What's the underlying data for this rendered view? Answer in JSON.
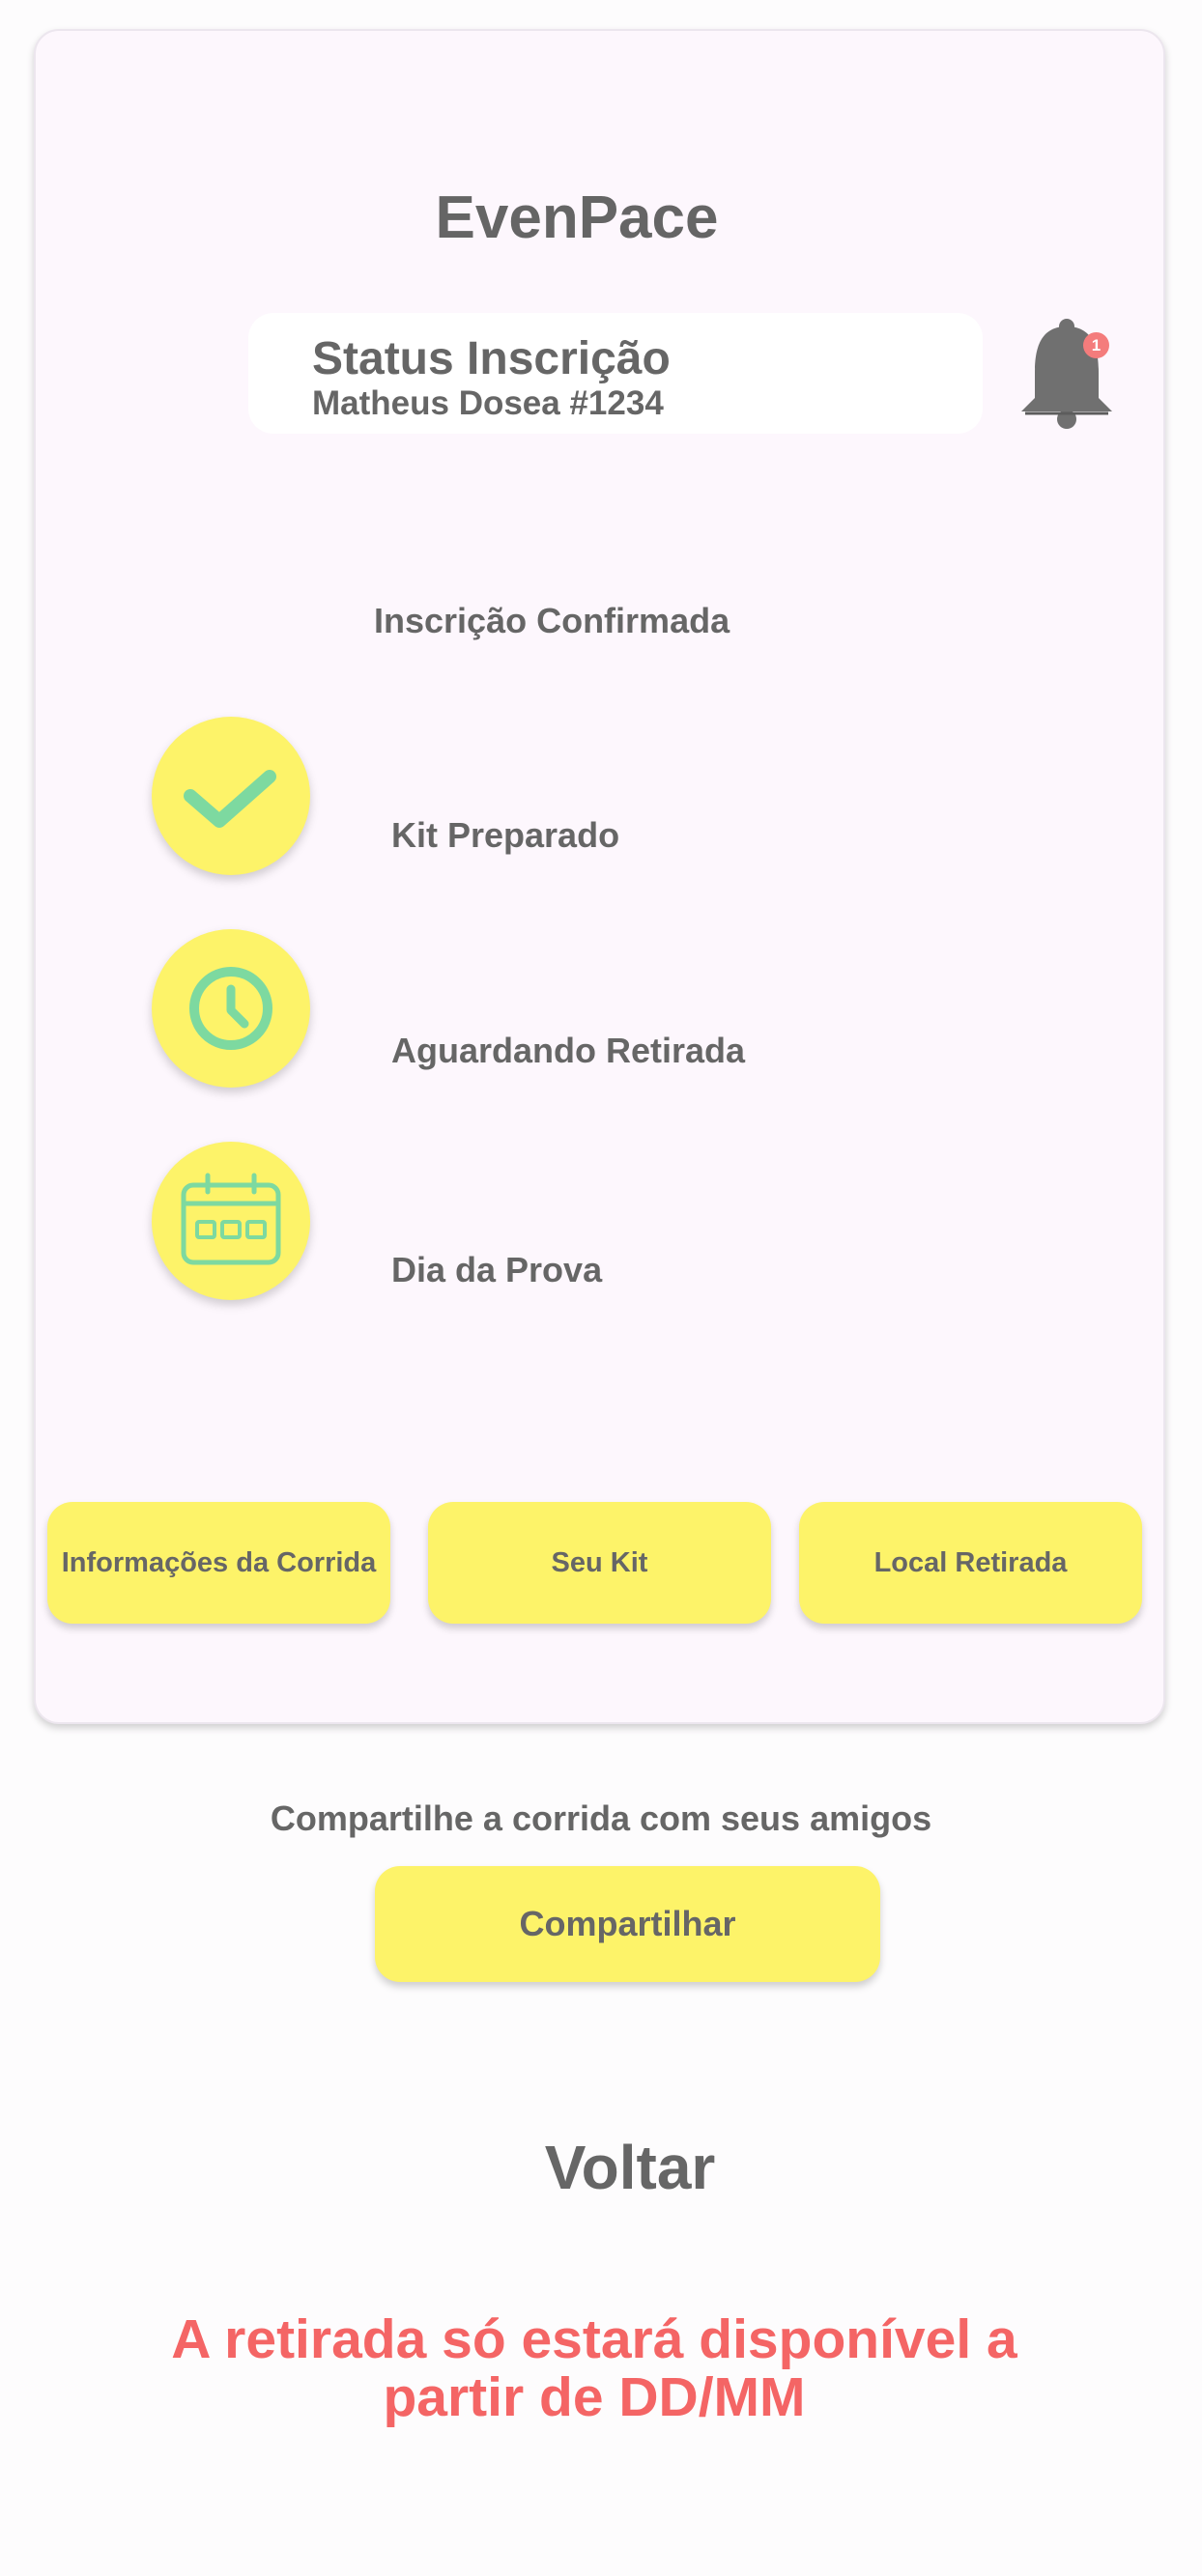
{
  "app": {
    "title": "EvenPace"
  },
  "status": {
    "title": "Status Inscrição",
    "subtitle": "Matheus Dosea #1234",
    "notification_count": "1"
  },
  "progress": {
    "confirmed_label": "Inscrição Confirmada",
    "steps": [
      {
        "label": "Kit Preparado",
        "icon": "check-icon",
        "icon_color": "#7dd9a0"
      },
      {
        "label": "Aguardando Retirada",
        "icon": "clock-icon",
        "icon_color": "#7dd9a0"
      },
      {
        "label": "Dia da Prova",
        "icon": "calendar-icon",
        "icon_color": "#7dd9a0"
      }
    ]
  },
  "actions": {
    "race_info": "Informações da Corrida",
    "your_kit": "Seu Kit",
    "pickup_location": "Local Retirada"
  },
  "share": {
    "text": "Compartilhe a corrida com seus amigos",
    "button": "Compartilhar"
  },
  "back": "Voltar",
  "warning": "A retirada só estará disponível a partir de DD/MM",
  "colors": {
    "accent": "#fdf369",
    "text": "#666666",
    "warning": "#f46565",
    "badge": "#f47c7c",
    "card_bg": "#fdf7fd"
  }
}
